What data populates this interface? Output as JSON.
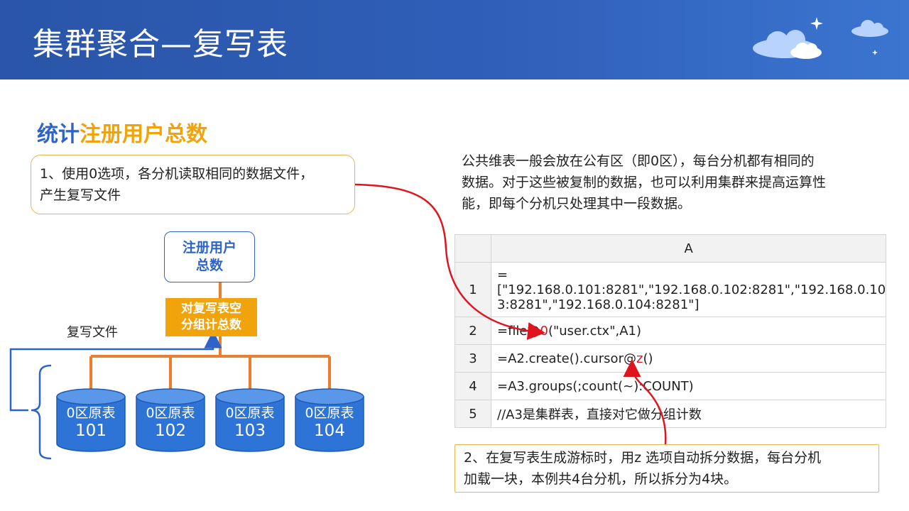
{
  "header": {
    "title": "集群聚合—复写表"
  },
  "subtitle": {
    "part1": "统计",
    "part2": "注册用户总数"
  },
  "callout1": {
    "line1": "1、使用0选项，各分机读取相同的数据文件，",
    "line2": "产生复写文件"
  },
  "paragraph": {
    "line1": "公共维表一般会放在公有区（即0区），每台分机都有相同的",
    "line2": "数据。对于这些被复制的数据，也可以利用集群来提高运算性",
    "line3": "能，即每个分机只处理其中一段数据。"
  },
  "diagram": {
    "top_box": {
      "line1": "注册用户",
      "line2": "总数"
    },
    "mid_box": {
      "line1": "对复写表空",
      "line2": "分组计总数"
    },
    "copy_label": "复写文件",
    "cylinders": [
      {
        "line1": "0区原表",
        "line2": "101"
      },
      {
        "line1": "0区原表",
        "line2": "102"
      },
      {
        "line1": "0区原表",
        "line2": "103"
      },
      {
        "line1": "0区原表",
        "line2": "104"
      }
    ]
  },
  "grid": {
    "column_header": "A",
    "rows": [
      {
        "num": "1",
        "line1": "=[\"192.168.0.101:8281\",\"192.168.0.102:8281\",\"192.168.0.10",
        "line2": "3:8281\",\"192.168.0.104:8281\"]"
      },
      {
        "num": "2",
        "pre": "=file@",
        "hl": "0",
        "post": "(\"user.ctx\",A1)"
      },
      {
        "num": "3",
        "pre": "=A2.create().cursor@",
        "hl": "z",
        "post": "()"
      },
      {
        "num": "4",
        "text": "=A3.groups(;count(~):COUNT)"
      },
      {
        "num": "5",
        "text": "//A3是集群表，直接对它做分组计数"
      }
    ]
  },
  "callout2": {
    "line1": "2、在复写表生成游标时，用z  选项自动拆分数据，每台分机",
    "line2": "加载一块，本例共4台分机，所以拆分为4块。"
  },
  "colors": {
    "header_blue": "#2f5fb9",
    "accent_blue": "#2e63c7",
    "accent_orange": "#f0a30a",
    "connector_orange": "#ed7d31",
    "arrow_red": "#e0141e"
  }
}
